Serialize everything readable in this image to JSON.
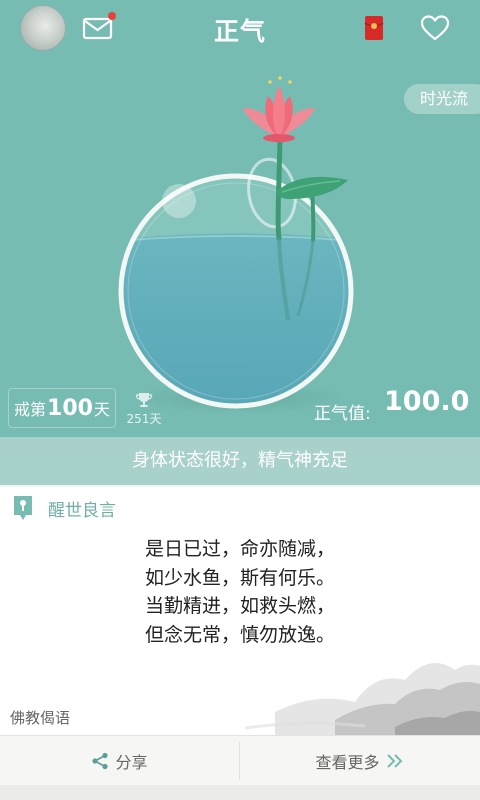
{
  "header": {
    "title": "正气",
    "has_unread_mail": true
  },
  "icons": {
    "avatar": "avatar-image",
    "mail": "mail-icon",
    "red_packet": "red-packet-icon",
    "favorite": "heart-icon",
    "trophy": "trophy-icon",
    "tag": "bookmark-tag-icon",
    "share": "share-icon",
    "more": "double-chevron-right-icon"
  },
  "colors": {
    "theme": "#76bcb2",
    "status_bar": "#a9d1cb",
    "accent_text": "#6fb0a6",
    "notification_dot": "#e8413a"
  },
  "stage": {
    "timeflow_label": "时光流",
    "abstain_prefix": "戒第",
    "abstain_days": "100",
    "abstain_suffix": "天",
    "trophy_count": "251天",
    "qi_label": "正气值:",
    "qi_value": "100.0"
  },
  "status_message": "身体状态很好，精气神充足",
  "quote_card": {
    "tag_label": "醒世良言",
    "poem_lines": [
      "是日已过，命亦随减，",
      "如少水鱼，斯有何乐。",
      "当勤精进，如救头燃，",
      "但念无常，慎勿放逸。"
    ],
    "source": "佛教偈语"
  },
  "bottom_bar": {
    "share_label": "分享",
    "more_label": "查看更多"
  }
}
